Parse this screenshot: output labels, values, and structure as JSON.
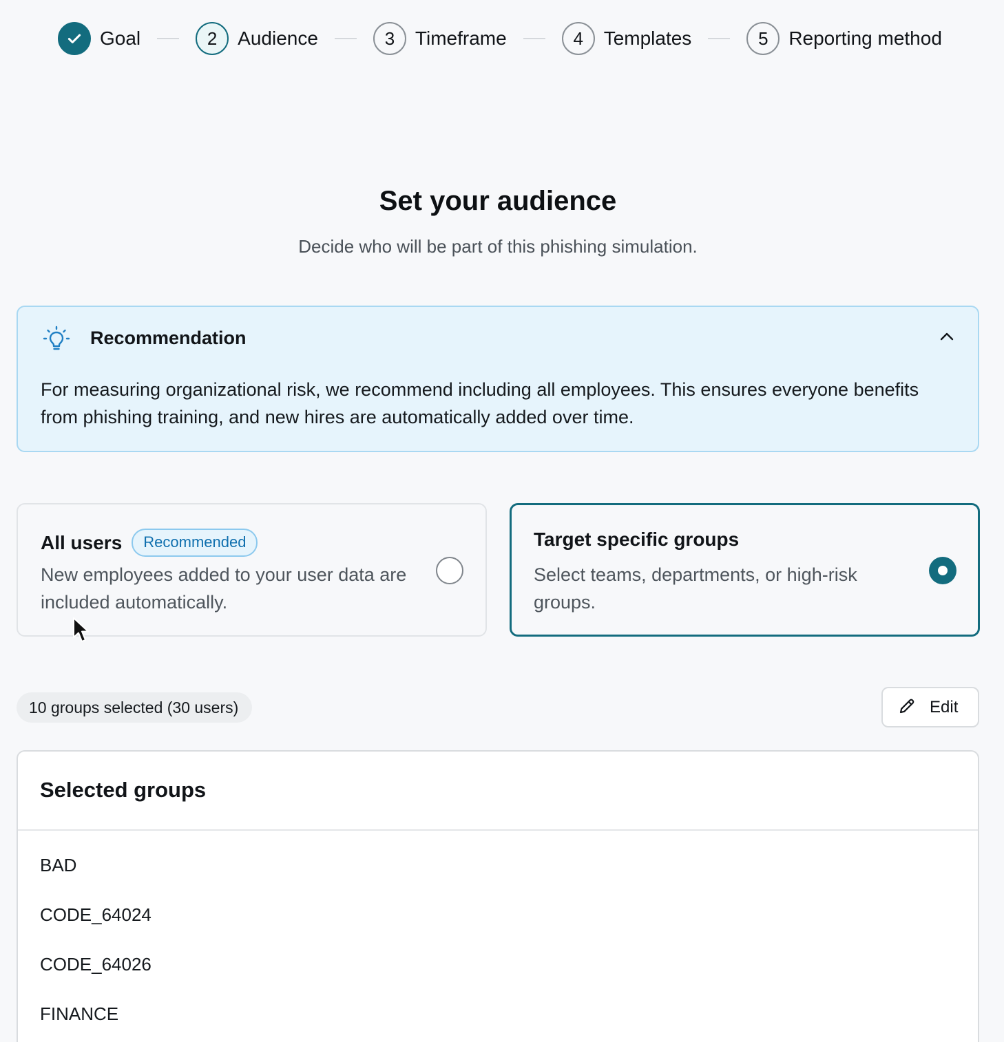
{
  "stepper": {
    "steps": [
      {
        "number": "",
        "label": "Goal",
        "state": "done"
      },
      {
        "number": "2",
        "label": "Audience",
        "state": "current"
      },
      {
        "number": "3",
        "label": "Timeframe",
        "state": "upcoming"
      },
      {
        "number": "4",
        "label": "Templates",
        "state": "upcoming"
      },
      {
        "number": "5",
        "label": "Reporting method",
        "state": "upcoming"
      }
    ]
  },
  "header": {
    "title": "Set your audience",
    "subtitle": "Decide who will be part of this phishing simulation."
  },
  "recommendation": {
    "title": "Recommendation",
    "body": "For measuring organizational risk, we recommend including all employees. This ensures everyone benefits from phishing training, and new hires are automatically added over time.",
    "expanded": true
  },
  "options": {
    "all_users": {
      "title": "All users",
      "badge": "Recommended",
      "description": "New employees added to your user data are included automatically.",
      "selected": false
    },
    "target_groups": {
      "title": "Target specific groups",
      "description": "Select teams, departments, or high-risk groups.",
      "selected": true
    }
  },
  "summary": {
    "text": "10 groups selected (30 users)",
    "edit_label": "Edit"
  },
  "selected_groups": {
    "title": "Selected groups",
    "items": [
      "BAD",
      "CODE_64024",
      "CODE_64026",
      "FINANCE"
    ]
  },
  "colors": {
    "accent": "#136c7e",
    "recommendation_bg": "#e6f4fc",
    "badge_text": "#0f6fae",
    "background": "#f7f8fa"
  },
  "icons": {
    "step_done": "check-icon",
    "recommendation": "lightbulb-icon",
    "collapse": "chevron-up-icon",
    "edit": "pencil-icon"
  }
}
